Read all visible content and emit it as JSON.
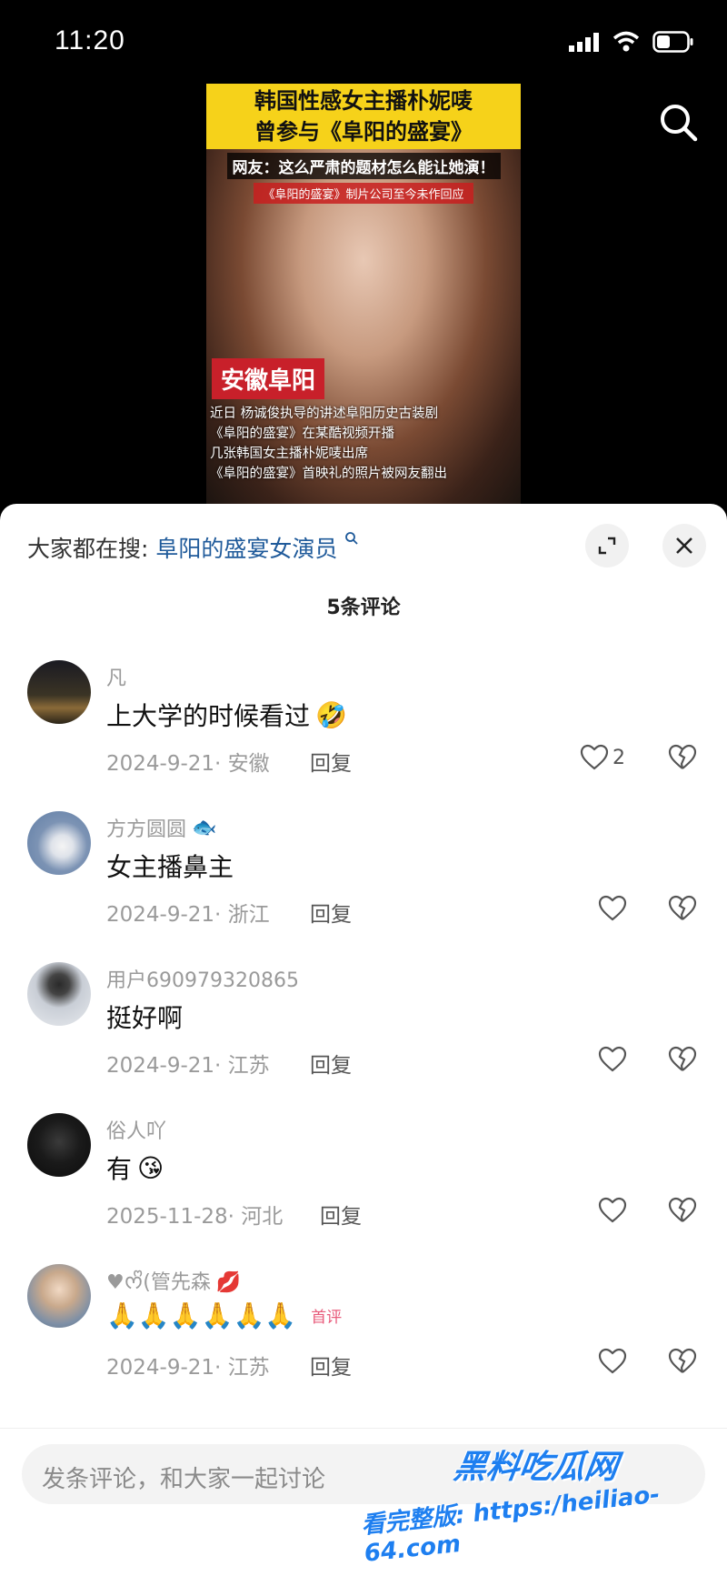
{
  "status": {
    "time": "11:20"
  },
  "video": {
    "title_line1": "韩国性感女主播朴妮唛",
    "title_line2": "曾参与《阜阳的盛宴》",
    "sub1": "网友：这么严肃的题材怎么能让她演！",
    "sub2": "《阜阳的盛宴》制片公司至今未作回应",
    "badge": "安徽阜阳",
    "body": [
      "近日 杨诚俊执导的讲述阜阳历史古装剧",
      "《阜阳的盛宴》在某酷视频开播",
      "几张韩国女主播朴妮唛出席",
      "《阜阳的盛宴》首映礼的照片被网友翻出"
    ]
  },
  "sheet": {
    "hot_prefix": "大家都在搜:",
    "hot_keyword": "阜阳的盛宴女演员",
    "comment_count": "5条评论"
  },
  "comments": [
    {
      "user": "凡",
      "text": "上大学的时候看过",
      "emoji": "🤣",
      "date": "2024-9-21",
      "region": "安徽",
      "reply": "回复",
      "likes": "2"
    },
    {
      "user": "方方圆圆",
      "user_emoji": "🐟",
      "text": "女主播鼻主",
      "emoji": "",
      "date": "2024-9-21",
      "region": "浙江",
      "reply": "回复",
      "likes": ""
    },
    {
      "user": "用户690979320865",
      "text": "挺好啊",
      "emoji": "",
      "date": "2024-9-21",
      "region": "江苏",
      "reply": "回复",
      "likes": ""
    },
    {
      "user": "俗人吖",
      "text": "有",
      "emoji": "😘",
      "date": "2025-11-28",
      "region": "河北",
      "reply": "回复",
      "likes": ""
    },
    {
      "user": "♥ᰔᩚ(管先森",
      "user_emoji": "💋",
      "text": "🙏🙏🙏🙏🙏🙏",
      "emoji": "",
      "badge": "首评",
      "date": "2024-9-21",
      "region": "江苏",
      "reply": "回复",
      "likes": ""
    }
  ],
  "input": {
    "placeholder": "发条评论，和大家一起讨论"
  },
  "watermark": {
    "line1": "黑料吃瓜网",
    "line2": "看完整版: https:/heiliao-64.com"
  },
  "colors": {
    "keyword": "#1f5a9a",
    "watermark": "#1e7ff0",
    "badge": "#e85a7a"
  }
}
